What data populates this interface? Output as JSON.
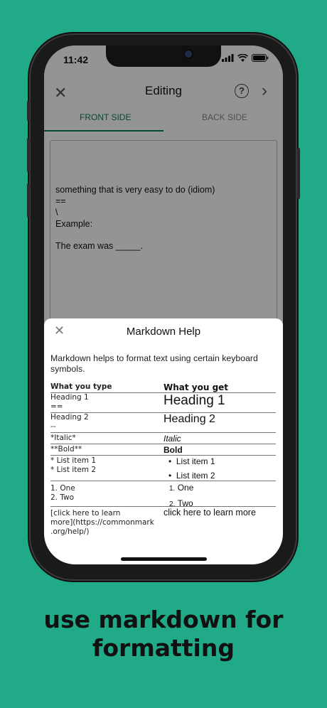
{
  "status_bar": {
    "time": "11:42"
  },
  "header": {
    "title": "Editing"
  },
  "tabs": [
    {
      "label": "FRONT SIDE",
      "active": true
    },
    {
      "label": "BACK SIDE",
      "active": false
    }
  ],
  "editor": {
    "lines": [
      "something that is very easy to do (idiom)",
      "==",
      "\\",
      "Example:",
      "",
      "The exam was _____."
    ]
  },
  "markdown_help": {
    "title": "Markdown Help",
    "intro": "Markdown helps to format text using certain keyboard symbols.",
    "col_type": "What you type",
    "col_get": "What you get",
    "rows": [
      {
        "type": [
          "Heading 1",
          "=="
        ],
        "get": [
          "Heading 1"
        ]
      },
      {
        "type": [
          "Heading 2",
          "--"
        ],
        "get": [
          "Heading 2"
        ]
      },
      {
        "type": [
          "*Italic*"
        ],
        "get": [
          "Italic"
        ]
      },
      {
        "type": [
          "**Bold**"
        ],
        "get": [
          "Bold"
        ]
      },
      {
        "type": [
          "* List item 1",
          "* List item 2"
        ],
        "get": [
          "List item 1",
          "List item 2"
        ]
      },
      {
        "type": [
          "1. One",
          "2. Two"
        ],
        "get": [
          "One",
          "Two"
        ]
      },
      {
        "type": [
          "[click here to learn",
          "more](https://commonmark",
          ".org/help/)"
        ],
        "get": [
          "click here to learn more"
        ]
      }
    ]
  },
  "caption": {
    "line1": "use markdown for",
    "line2": "formatting"
  },
  "colors": {
    "background": "#21aa88",
    "accent": "#0d7d52",
    "link": "#2a88c7"
  },
  "icons": [
    "close-icon",
    "help-icon",
    "chevron-right-icon",
    "signal-icon",
    "wifi-icon",
    "battery-icon"
  ]
}
